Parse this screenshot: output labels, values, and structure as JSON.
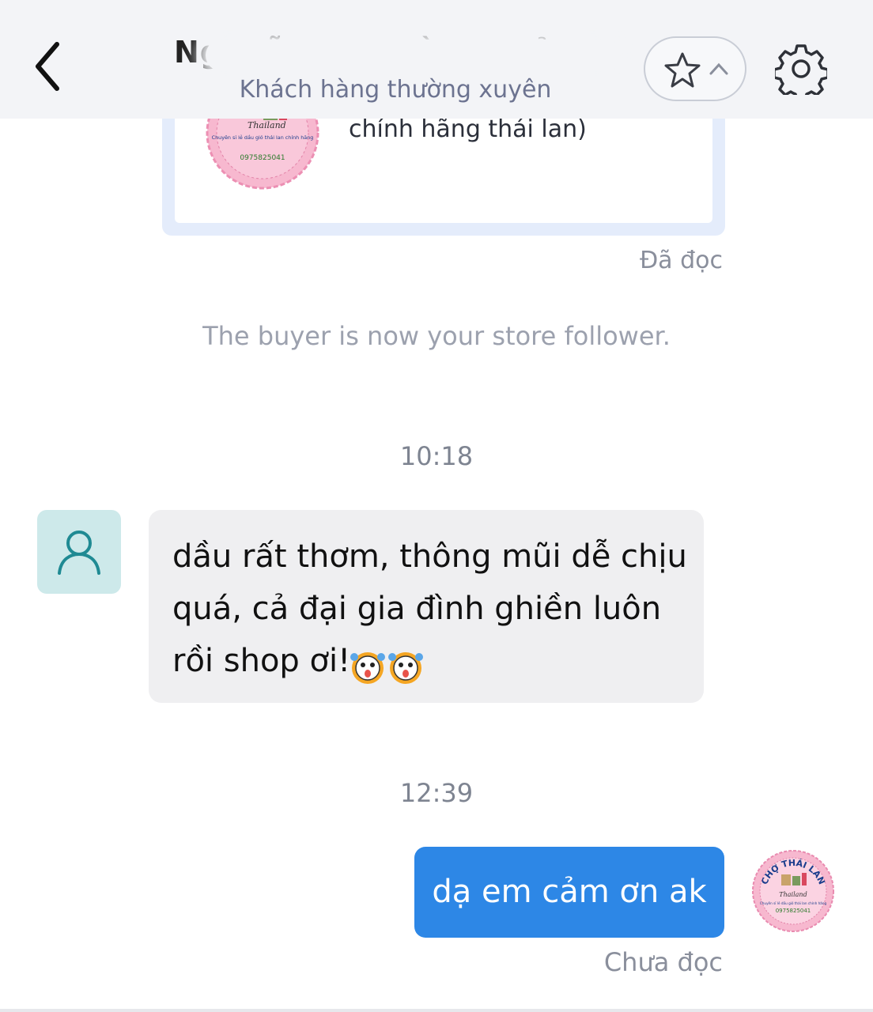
{
  "header": {
    "title": "Nguyễn Thị Hồng Thảo",
    "subtitle": "Khách hàng thường xuyên",
    "icons": {
      "back": "chevron-left-icon",
      "favorite": "star-icon",
      "favorite_expand": "chevron-up-icon",
      "settings": "gear-icon"
    }
  },
  "product_card": {
    "name": "chính hãng thái lan)",
    "logo_text": {
      "brand": "Thailand",
      "tagline": "Chuyên sỉ lẻ dầu gió thái lan chính hãng",
      "phone": "0975825041"
    }
  },
  "messages": {
    "read_status_1": "Đã đọc",
    "system_notice": "The buyer is now your store follower.",
    "time_1": "10:18",
    "incoming_text": "dầu rất thơm, thông mũi dễ chịu quá, cả đại gia đình ghiền luôn rồi shop ơi!",
    "time_2": "12:39",
    "outgoing_text": "dạ em cảm ơn ak",
    "read_status_2": "Chưa đọc"
  },
  "shop_avatar": {
    "arc_text": "CHỢ THÁI LAN",
    "brand": "Thailand",
    "tagline": "Chuyên sỉ lẻ dầu gió thái lan chính hãng",
    "phone": "0975825041"
  },
  "colors": {
    "header_bg": "#f3f4f7",
    "incoming_bubble": "#efeff1",
    "outgoing_bubble": "#2d87e6",
    "avatar_bg": "#cde9ea",
    "avatar_icon": "#1f8a93",
    "logo_pink": "#f7b8cf"
  }
}
